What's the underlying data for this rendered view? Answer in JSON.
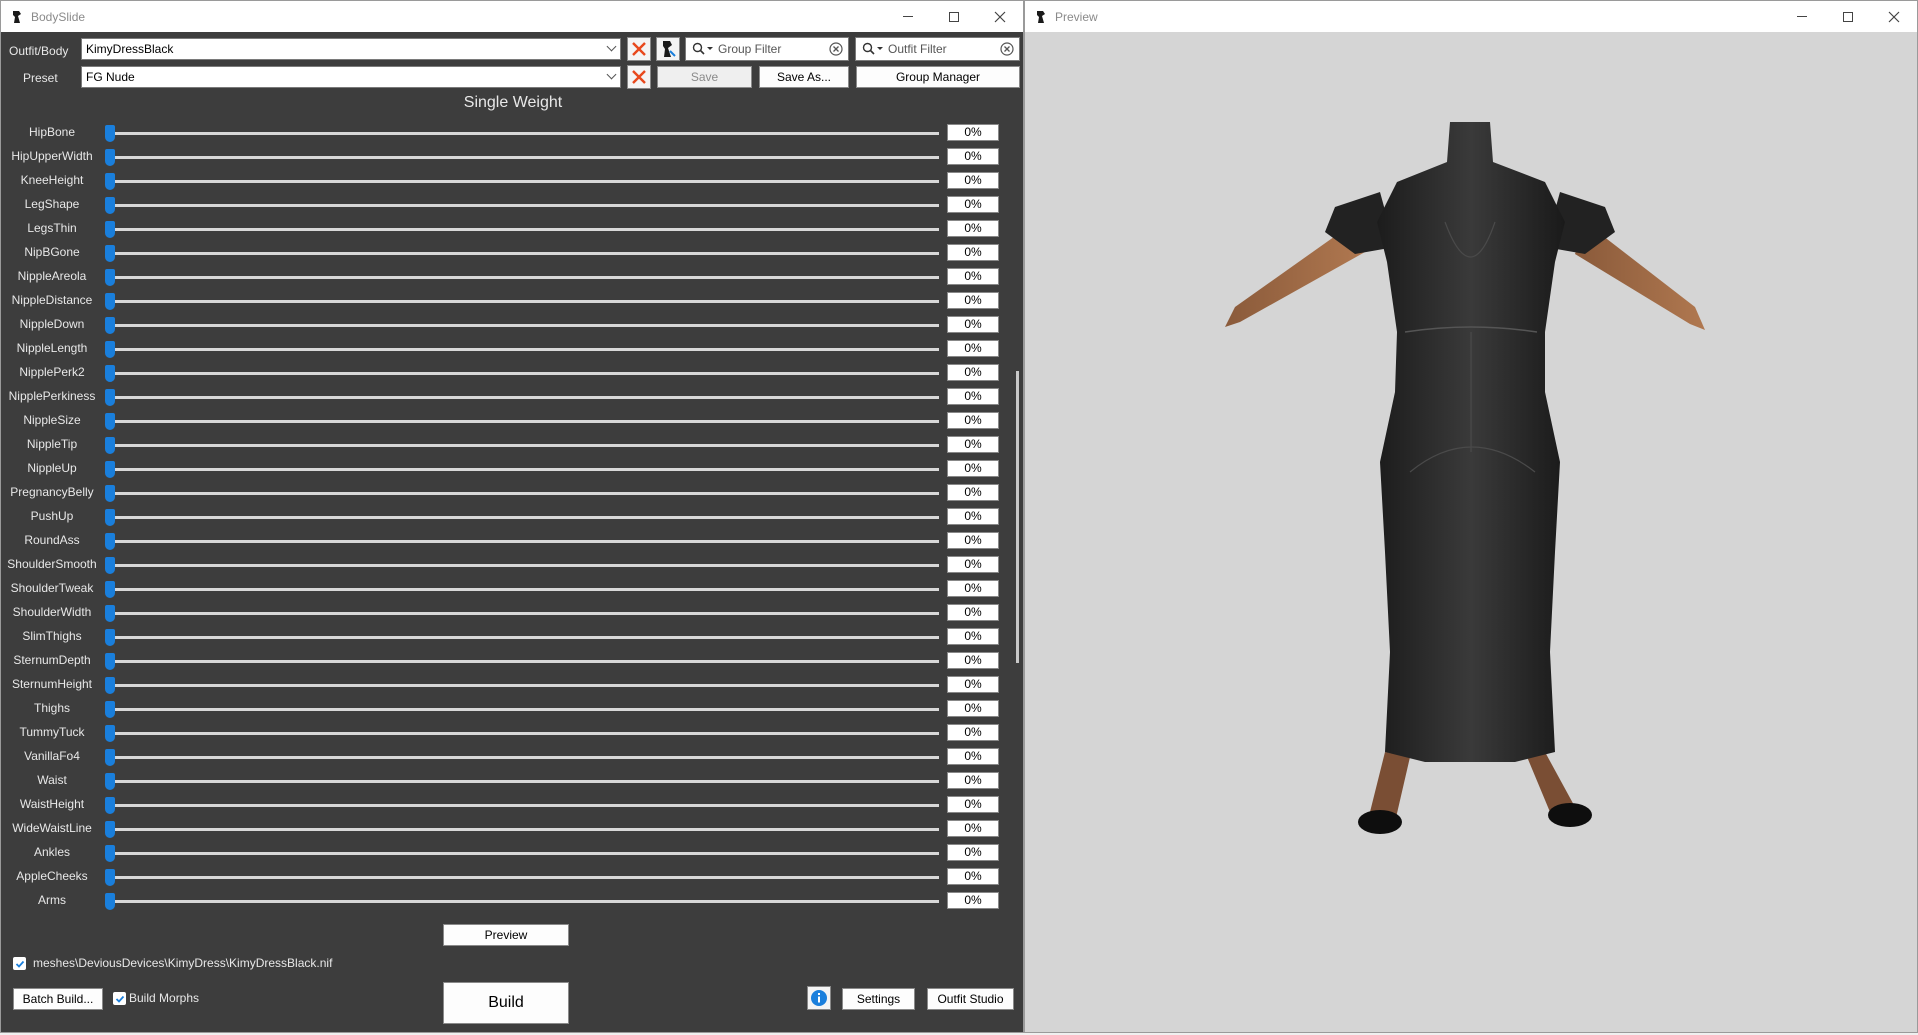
{
  "bodyslide": {
    "title": "BodySlide",
    "outfit_label": "Outfit/Body",
    "outfit_value": "KimyDressBlack",
    "preset_label": "Preset",
    "preset_value": "FG Nude",
    "group_filter": "Group Filter",
    "outfit_filter": "Outfit Filter",
    "save": "Save",
    "save_as": "Save As...",
    "group_manager": "Group Manager",
    "panel_title": "Single Weight",
    "sliders": [
      {
        "name": "HipBone",
        "value": "0%"
      },
      {
        "name": "HipUpperWidth",
        "value": "0%"
      },
      {
        "name": "KneeHeight",
        "value": "0%"
      },
      {
        "name": "LegShape",
        "value": "0%"
      },
      {
        "name": "LegsThin",
        "value": "0%"
      },
      {
        "name": "NipBGone",
        "value": "0%"
      },
      {
        "name": "NippleAreola",
        "value": "0%"
      },
      {
        "name": "NippleDistance",
        "value": "0%"
      },
      {
        "name": "NippleDown",
        "value": "0%"
      },
      {
        "name": "NippleLength",
        "value": "0%"
      },
      {
        "name": "NipplePerk2",
        "value": "0%"
      },
      {
        "name": "NipplePerkiness",
        "value": "0%"
      },
      {
        "name": "NippleSize",
        "value": "0%"
      },
      {
        "name": "NippleTip",
        "value": "0%"
      },
      {
        "name": "NippleUp",
        "value": "0%"
      },
      {
        "name": "PregnancyBelly",
        "value": "0%"
      },
      {
        "name": "PushUp",
        "value": "0%"
      },
      {
        "name": "RoundAss",
        "value": "0%"
      },
      {
        "name": "ShoulderSmooth",
        "value": "0%"
      },
      {
        "name": "ShoulderTweak",
        "value": "0%"
      },
      {
        "name": "ShoulderWidth",
        "value": "0%"
      },
      {
        "name": "SlimThighs",
        "value": "0%"
      },
      {
        "name": "SternumDepth",
        "value": "0%"
      },
      {
        "name": "SternumHeight",
        "value": "0%"
      },
      {
        "name": "Thighs",
        "value": "0%"
      },
      {
        "name": "TummyTuck",
        "value": "0%"
      },
      {
        "name": "VanillaFo4",
        "value": "0%"
      },
      {
        "name": "Waist",
        "value": "0%"
      },
      {
        "name": "WaistHeight",
        "value": "0%"
      },
      {
        "name": "WideWaistLine",
        "value": "0%"
      },
      {
        "name": "Ankles",
        "value": "0%"
      },
      {
        "name": "AppleCheeks",
        "value": "0%"
      },
      {
        "name": "Arms",
        "value": "0%"
      }
    ],
    "preview_button": "Preview",
    "output_path": "meshes\\DeviousDevices\\KimyDress\\KimyDressBlack.nif",
    "output_path_checked": true,
    "batch_build": "Batch Build...",
    "build_morphs": "Build Morphs",
    "build_morphs_checked": true,
    "build": "Build",
    "settings": "Settings",
    "outfit_studio": "Outfit Studio"
  },
  "preview": {
    "title": "Preview"
  },
  "colors": {
    "panel_bg": "#3d3d3d",
    "slider_thumb": "#1a7fdc",
    "viewport_bg": "#d5d5d5",
    "clear_x": "#e8481c"
  }
}
